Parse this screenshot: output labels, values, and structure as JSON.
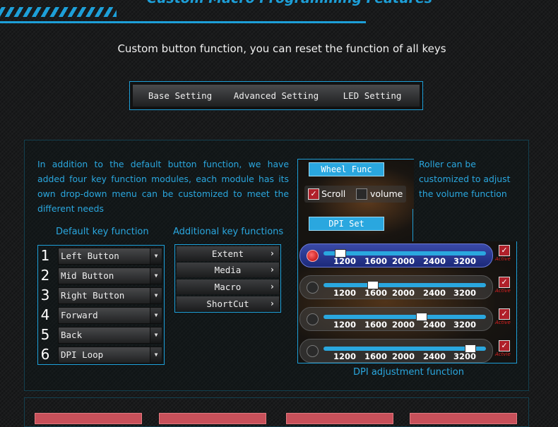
{
  "header": {
    "title": "Custom Macro Programming Features",
    "subtitle": "Custom button function, you can reset the function of all keys"
  },
  "tabs": [
    "Base Setting",
    "Advanced Setting",
    "LED Setting"
  ],
  "description_left": "In addition to the default button function, we have added four key function modules, each module has its own drop-down menu can be customized to meet the different needs",
  "description_right": "Roller can be customized to adjust the volume function",
  "default_keys": {
    "label": "Default key function",
    "items": [
      {
        "num": "1",
        "value": "Left Button"
      },
      {
        "num": "2",
        "value": "Mid Button"
      },
      {
        "num": "3",
        "value": "Right Button"
      },
      {
        "num": "4",
        "value": "Forward"
      },
      {
        "num": "5",
        "value": "Back"
      },
      {
        "num": "6",
        "value": "DPI Loop"
      }
    ]
  },
  "additional_keys": {
    "label": "Additional key functions",
    "items": [
      "Extent",
      "Media",
      "Macro",
      "ShortCut"
    ]
  },
  "wheel": {
    "label": "Wheel Func",
    "options": [
      {
        "label": "Scroll",
        "checked": true
      },
      {
        "label": "volume",
        "checked": false
      }
    ]
  },
  "dpi": {
    "label": "DPI Set",
    "ticks": [
      "1200",
      "1600",
      "2000",
      "2400",
      "3200"
    ],
    "rows": [
      {
        "selected": true,
        "level": 0.1,
        "active_label": "Active"
      },
      {
        "selected": false,
        "level": 0.3,
        "active_label": "Active"
      },
      {
        "selected": false,
        "level": 0.6,
        "active_label": "Active"
      },
      {
        "selected": false,
        "level": 0.9,
        "active_label": "Actvie"
      }
    ],
    "caption": "DPI adjustment function"
  },
  "colors": {
    "accent": "#1d9fd8",
    "text_accent": "#2aa7df",
    "active_red": "#e02020"
  }
}
